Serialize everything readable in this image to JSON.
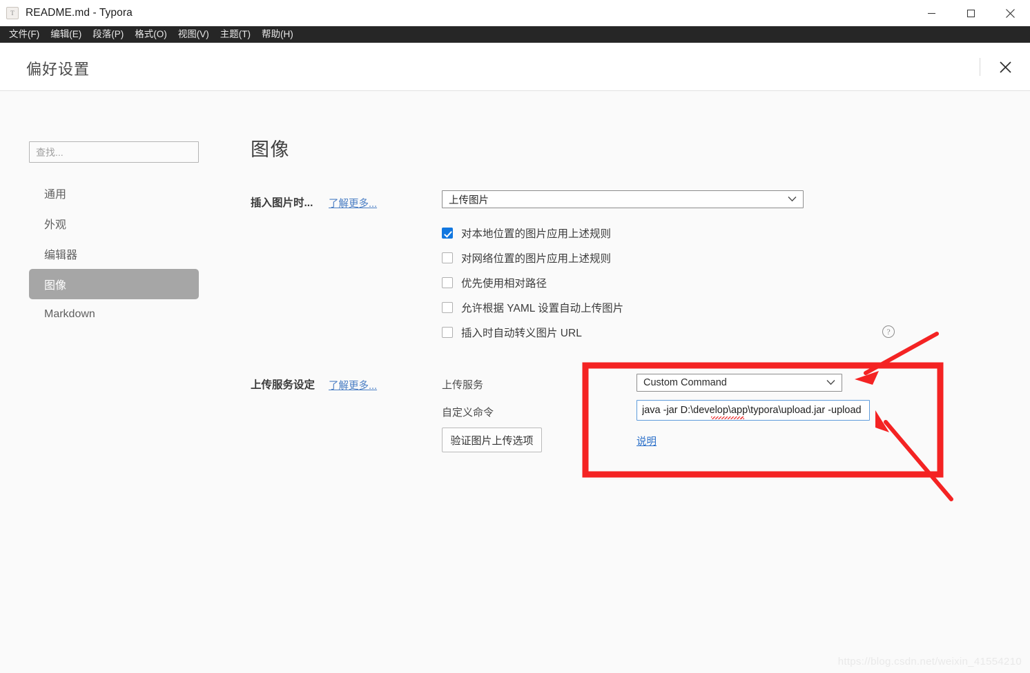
{
  "window": {
    "title": "README.md - Typora",
    "app_icon_letter": "T",
    "controls": {
      "minimize": "minimize-icon",
      "maximize": "maximize-icon",
      "close": "close-icon"
    }
  },
  "menubar": {
    "items": [
      {
        "label": "文件(F)"
      },
      {
        "label": "编辑(E)"
      },
      {
        "label": "段落(P)"
      },
      {
        "label": "格式(O)"
      },
      {
        "label": "视图(V)"
      },
      {
        "label": "主题(T)"
      },
      {
        "label": "帮助(H)"
      }
    ]
  },
  "preferences": {
    "title": "偏好设置",
    "close_label": "×"
  },
  "sidebar": {
    "search": {
      "placeholder": "查找...",
      "value": ""
    },
    "items": [
      {
        "label": "通用",
        "selected": false
      },
      {
        "label": "外观",
        "selected": false
      },
      {
        "label": "编辑器",
        "selected": false
      },
      {
        "label": "图像",
        "selected": true
      },
      {
        "label": "Markdown",
        "selected": false
      }
    ]
  },
  "main": {
    "section_title": "图像",
    "insert_rule": {
      "label": "插入图片时...",
      "learn_more": "了解更多...",
      "select_value": "上传图片"
    },
    "checkboxes": [
      {
        "label": "对本地位置的图片应用上述规则",
        "checked": true
      },
      {
        "label": "对网络位置的图片应用上述规则",
        "checked": false
      },
      {
        "label": "优先使用相对路径",
        "checked": false
      },
      {
        "label": "允许根据 YAML 设置自动上传图片",
        "checked": false
      },
      {
        "label": "插入时自动转义图片 URL",
        "checked": false
      }
    ],
    "upload_section": {
      "label": "上传服务设定",
      "learn_more": "了解更多...",
      "service_label": "上传服务",
      "service_value": "Custom Command",
      "command_label": "自定义命令",
      "command_value": "java -jar D:\\develop\\app\\typora\\upload.jar -upload",
      "validate_button": "验证图片上传选项",
      "help_link": "说明"
    }
  },
  "annotations": {
    "highlight_color": "#f42323",
    "arrow_count": 2
  },
  "watermark": "https://blog.csdn.net/weixin_41554210"
}
